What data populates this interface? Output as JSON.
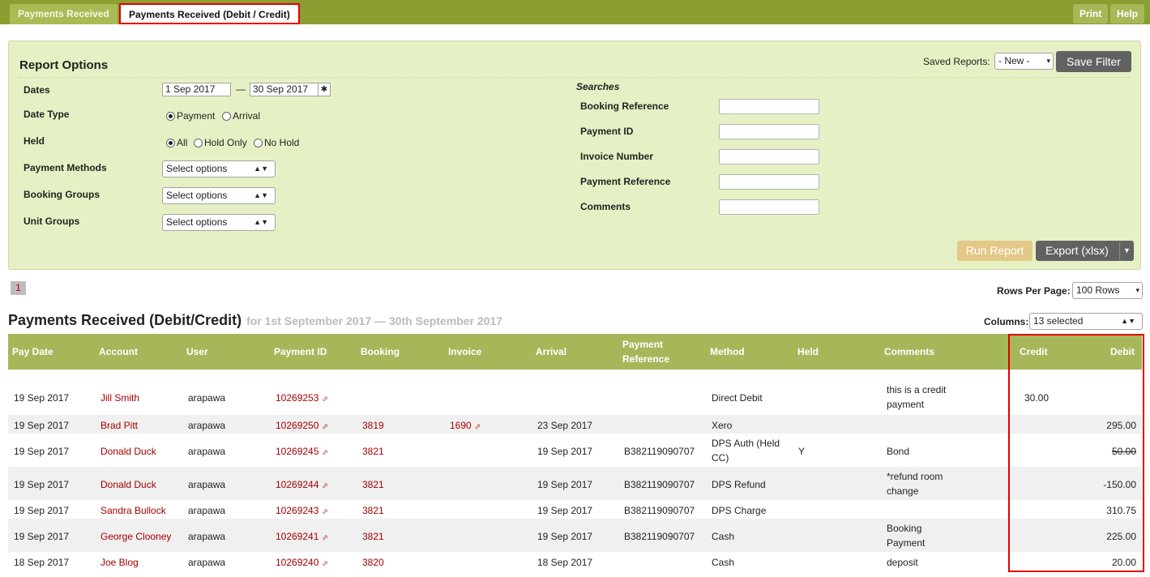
{
  "top_tabs": [
    {
      "label": "Payments Received"
    },
    {
      "label": "Payments Received (Debit / Credit)"
    }
  ],
  "top_buttons": {
    "print": "Print",
    "help": "Help"
  },
  "report_options": {
    "title": "Report Options",
    "saved_reports_label": "Saved Reports:",
    "saved_reports_value": "- New -",
    "save_filter": "Save Filter",
    "dates_label": "Dates",
    "date_from": "1 Sep 2017",
    "date_sep": "—",
    "date_to": "30 Sep 2017",
    "date_type_label": "Date Type",
    "date_type_options": [
      "Payment",
      "Arrival"
    ],
    "held_label": "Held",
    "held_options": [
      "All",
      "Hold Only",
      "No Hold"
    ],
    "payment_methods_label": "Payment Methods",
    "booking_groups_label": "Booking Groups",
    "unit_groups_label": "Unit Groups",
    "select_placeholder": "Select options",
    "searches_title": "Searches",
    "search_fields": [
      "Booking Reference",
      "Payment ID",
      "Invoice Number",
      "Payment Reference",
      "Comments"
    ],
    "run_report": "Run Report",
    "export": "Export (xlsx)"
  },
  "pagination": {
    "current_page": "1",
    "rows_per_page_label": "Rows Per Page:",
    "rows_per_page": "100 Rows"
  },
  "report": {
    "title": "Payments Received (Debit/Credit)",
    "subtitle": "for 1st September 2017 — 30th September 2017",
    "columns_label": "Columns:",
    "columns_value": "13 selected"
  },
  "table": {
    "headers": {
      "pay_date": "Pay Date",
      "account": "Account",
      "user": "User",
      "payment_id": "Payment ID",
      "booking": "Booking",
      "invoice": "Invoice",
      "arrival": "Arrival",
      "pay_ref_1": "Payment",
      "pay_ref_2": "Reference",
      "method": "Method",
      "held": "Held",
      "comments": "Comments",
      "credit": "Credit",
      "debit": "Debit"
    },
    "rows": [
      {
        "pay_date": "19 Sep 2017",
        "account": "Jill Smith",
        "user": "arapawa",
        "payment_id": "10269253",
        "booking": "",
        "invoice": "",
        "arrival": "",
        "pay_ref": "",
        "method": "Direct Debit",
        "method2": "",
        "held": "",
        "comments": "this is a credit",
        "comments2": "payment",
        "credit": "30.00",
        "debit": ""
      },
      {
        "pay_date": "19 Sep 2017",
        "account": "Brad Pitt",
        "user": "arapawa",
        "payment_id": "10269250",
        "booking": "3819",
        "invoice": "1690",
        "arrival": "23 Sep 2017",
        "pay_ref": "",
        "method": "Xero",
        "method2": "",
        "held": "",
        "comments": "",
        "comments2": "",
        "credit": "",
        "debit": "295.00"
      },
      {
        "pay_date": "19 Sep 2017",
        "account": "Donald Duck",
        "user": "arapawa",
        "payment_id": "10269245",
        "booking": "3821",
        "invoice": "",
        "arrival": "19 Sep 2017",
        "pay_ref": "B382119090707",
        "method": "DPS Auth (Held",
        "method2": "CC)",
        "held": "Y",
        "comments": "Bond",
        "comments2": "",
        "credit": "",
        "debit": "50.00"
      },
      {
        "pay_date": "19 Sep 2017",
        "account": "Donald Duck",
        "user": "arapawa",
        "payment_id": "10269244",
        "booking": "3821",
        "invoice": "",
        "arrival": "19 Sep 2017",
        "pay_ref": "B382119090707",
        "method": "DPS Refund",
        "method2": "",
        "held": "",
        "comments": "*refund room",
        "comments2": "change",
        "credit": "",
        "debit": "-150.00"
      },
      {
        "pay_date": "19 Sep 2017",
        "account": "Sandra Bullock",
        "user": "arapawa",
        "payment_id": "10269243",
        "booking": "3821",
        "invoice": "",
        "arrival": "19 Sep 2017",
        "pay_ref": "B382119090707",
        "method": "DPS Charge",
        "method2": "",
        "held": "",
        "comments": "",
        "comments2": "",
        "credit": "",
        "debit": "310.75"
      },
      {
        "pay_date": "19 Sep 2017",
        "account": "George Clooney",
        "user": "arapawa",
        "payment_id": "10269241",
        "booking": "3821",
        "invoice": "",
        "arrival": "19 Sep 2017",
        "pay_ref": "B382119090707",
        "method": "Cash",
        "method2": "",
        "held": "",
        "comments": "Booking",
        "comments2": "Payment",
        "credit": "",
        "debit": "225.00"
      },
      {
        "pay_date": "18 Sep 2017",
        "account": "Joe Blog",
        "user": "arapawa",
        "payment_id": "10269240",
        "booking": "3820",
        "invoice": "",
        "arrival": "18 Sep 2017",
        "pay_ref": "",
        "method": "Cash",
        "method2": "",
        "held": "",
        "comments": "deposit",
        "comments2": "",
        "credit": "",
        "debit": "20.00"
      }
    ]
  },
  "icons": {
    "calendar": "gear-icon",
    "external_link": "external-link-icon",
    "dropdown": "chevron-down-icon"
  },
  "colors": {
    "topbar": "#8a9e32",
    "panel": "#e5f1c4",
    "table_header": "#a6b75a",
    "link": "#a40000",
    "highlight": "#e30000"
  }
}
